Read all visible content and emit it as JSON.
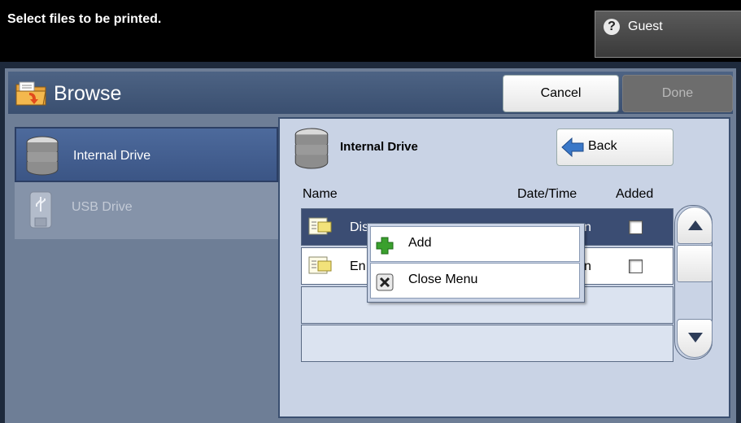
{
  "top_bar": {
    "instruction": "Select files to be printed.",
    "user": {
      "label": "Guest",
      "icon": "help-question-icon",
      "icon_glyph": "?"
    }
  },
  "header": {
    "title": "Browse",
    "icon": "folder-browse-icon",
    "cancel_label": "Cancel",
    "done_label": "Done"
  },
  "sidebar": {
    "items": [
      {
        "label": "Internal Drive",
        "icon": "database-drive-icon",
        "selected": true,
        "enabled": true
      },
      {
        "label": "USB Drive",
        "icon": "usb-drive-icon",
        "selected": false,
        "enabled": false
      }
    ]
  },
  "browser": {
    "drive_title": "Internal Drive",
    "back_label": "Back",
    "columns": {
      "name": "Name",
      "date": "Date/Time",
      "added": "Added"
    },
    "rows": [
      {
        "name": "Dis",
        "date": "n",
        "selected": true,
        "added": false,
        "icon": "document-file-icon"
      },
      {
        "name": "En",
        "date": "n",
        "selected": false,
        "added": false,
        "icon": "document-file-icon"
      },
      {
        "name": "",
        "date": "",
        "selected": false,
        "empty": true
      },
      {
        "name": "",
        "date": "",
        "selected": false,
        "empty": true
      }
    ]
  },
  "context_menu": {
    "items": [
      {
        "label": "Add",
        "icon": "plus-add-icon"
      },
      {
        "label": "Close Menu",
        "icon": "close-x-icon"
      }
    ]
  },
  "colors": {
    "header_bg": "#3a4f70",
    "panel_bg": "#c9d3e5",
    "selected_row": "#3b4d73",
    "add_green": "#3aa02e"
  }
}
